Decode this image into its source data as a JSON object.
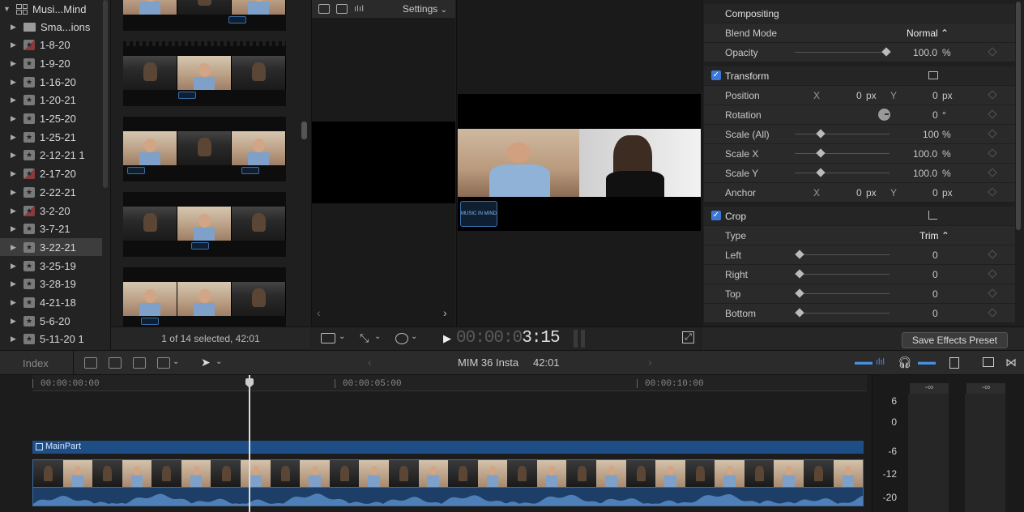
{
  "library": {
    "name": "Musi...Mind",
    "items": [
      {
        "label": "Sma...ions",
        "kind": "folder"
      },
      {
        "label": "1-8-20",
        "kind": "event-red"
      },
      {
        "label": "1-9-20",
        "kind": "event"
      },
      {
        "label": "1-16-20",
        "kind": "event"
      },
      {
        "label": "1-20-21",
        "kind": "event"
      },
      {
        "label": "1-25-20",
        "kind": "event"
      },
      {
        "label": "1-25-21",
        "kind": "event"
      },
      {
        "label": "2-12-21 1",
        "kind": "event"
      },
      {
        "label": "2-17-20",
        "kind": "event-red"
      },
      {
        "label": "2-22-21",
        "kind": "event"
      },
      {
        "label": "3-2-20",
        "kind": "event-red"
      },
      {
        "label": "3-7-21",
        "kind": "event"
      },
      {
        "label": "3-22-21",
        "kind": "event",
        "selected": true
      },
      {
        "label": "3-25-19",
        "kind": "event"
      },
      {
        "label": "3-28-19",
        "kind": "event"
      },
      {
        "label": "4-21-18",
        "kind": "event"
      },
      {
        "label": "5-6-20",
        "kind": "event"
      },
      {
        "label": "5-11-20 1",
        "kind": "event"
      }
    ]
  },
  "browser": {
    "status": "1 of 14 selected, 42:01"
  },
  "viewer": {
    "settings_label": "Settings",
    "logo_text": "MUSIC IN MIND",
    "timecode_dim": "00:00:0",
    "timecode_bright": "3:15"
  },
  "inspector": {
    "compositing": {
      "title": "Compositing",
      "blend_mode_label": "Blend Mode",
      "blend_mode_value": "Normal",
      "opacity_label": "Opacity",
      "opacity_value": "100.0",
      "opacity_unit": "%"
    },
    "transform": {
      "title": "Transform",
      "enabled": true,
      "position_label": "Position",
      "x_label": "X",
      "y_label": "Y",
      "position_x": "0",
      "position_y": "0",
      "px_unit": "px",
      "rotation_label": "Rotation",
      "rotation_value": "0",
      "rotation_unit": "°",
      "scale_all_label": "Scale (All)",
      "scale_all_value": "100",
      "scale_x_label": "Scale X",
      "scale_x_value": "100.0",
      "scale_y_label": "Scale Y",
      "scale_y_value": "100.0",
      "percent_unit": "%",
      "anchor_label": "Anchor",
      "anchor_x": "0",
      "anchor_y": "0"
    },
    "crop": {
      "title": "Crop",
      "enabled": true,
      "type_label": "Type",
      "type_value": "Trim",
      "left_label": "Left",
      "left_value": "0",
      "right_label": "Right",
      "right_value": "0",
      "top_label": "Top",
      "top_value": "0",
      "bottom_label": "Bottom",
      "bottom_value": "0"
    },
    "save_button": "Save Effects Preset"
  },
  "timeline_bar": {
    "index_label": "Index",
    "project_name": "MIM 36 Insta",
    "duration": "42:01"
  },
  "timeline": {
    "ruler": [
      "00:00:00:00",
      "00:00:05:00",
      "00:00:10:00"
    ],
    "clip_name": "MainPart"
  },
  "meters": {
    "peak_left": "-∞",
    "peak_right": "-∞",
    "scale": [
      "6",
      "0",
      "-6",
      "-12",
      "-20"
    ]
  },
  "colors": {
    "accent": "#3c78d8",
    "clip_blue": "#1f4d86"
  }
}
